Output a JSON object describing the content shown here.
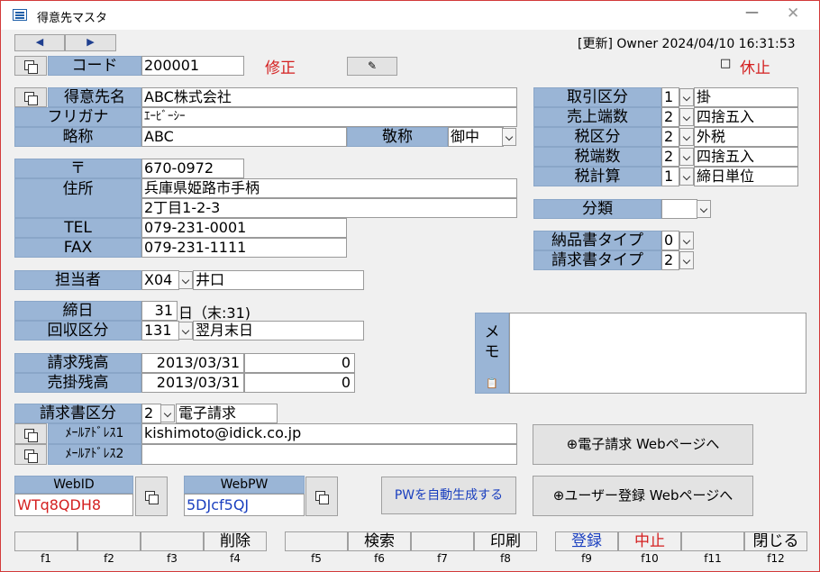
{
  "window": {
    "title": "得意先マスタ",
    "minimize": "—",
    "close": "✕"
  },
  "nav": {
    "prev": "◀",
    "next": "▶"
  },
  "status": "[更新] Owner 2024/04/10 16:31:53",
  "code": {
    "label": "コード",
    "value": "200001",
    "mode": "修正"
  },
  "inactive": {
    "checkbox": "□",
    "label": "休止"
  },
  "customer": {
    "name_label": "得意先名",
    "name": "ABC株式会社",
    "kana_label": "フリガナ",
    "kana": "ｴｰﾋﾞｰｼｰ",
    "short_label": "略称",
    "short": "ABC",
    "honorific_label": "敬称",
    "honorific": "御中"
  },
  "address": {
    "zip_label": "〒",
    "zip": "670-0972",
    "addr_label": "住所",
    "addr1": "兵庫県姫路市手柄",
    "addr2": "2丁目1-2-3",
    "tel_label": "TEL",
    "tel": "079-231-0001",
    "fax_label": "FAX",
    "fax": "079-231-1111"
  },
  "staff": {
    "label": "担当者",
    "code": "X04",
    "name": "井口"
  },
  "closing": {
    "label": "締日",
    "day": "31",
    "suffix": "日（末:31)"
  },
  "collection": {
    "label": "回収区分",
    "code": "131",
    "name": "翌月末日"
  },
  "balances": {
    "billing_label": "請求残高",
    "billing_date": "2013/03/31",
    "billing_value": "0",
    "ar_label": "売掛残高",
    "ar_date": "2013/03/31",
    "ar_value": "0"
  },
  "billing": {
    "label": "請求書区分",
    "code": "2",
    "name": "電子請求"
  },
  "mail": {
    "label1": "ﾒｰﾙｱﾄﾞﾚｽ1",
    "value1": "kishimoto@idick.co.jp",
    "label2": "ﾒｰﾙｱﾄﾞﾚｽ2",
    "value2": ""
  },
  "web": {
    "id_label": "WebID",
    "id_value": "WTq8QDH8",
    "pw_label": "WebPW",
    "pw_value": "5DJcf5QJ",
    "autogen": "PWを自動生成する"
  },
  "trade": {
    "rows": [
      {
        "label": "取引区分",
        "code": "1",
        "name": "掛"
      },
      {
        "label": "売上端数",
        "code": "2",
        "name": "四捨五入"
      },
      {
        "label": "税区分",
        "code": "2",
        "name": "外税"
      },
      {
        "label": "税端数",
        "code": "2",
        "name": "四捨五入"
      },
      {
        "label": "税計算",
        "code": "1",
        "name": "締日単位"
      }
    ]
  },
  "category": {
    "label": "分類",
    "value": ""
  },
  "delivery": {
    "label": "納品書タイプ",
    "value": "0"
  },
  "invoice": {
    "label": "請求書タイプ",
    "value": "2"
  },
  "memo": {
    "label": "メモ",
    "value": ""
  },
  "links": {
    "ebill": "⊕電子請求 Webページへ",
    "register": "⊕ユーザー登録 Webページへ"
  },
  "fkeys": {
    "labels": [
      "",
      "",
      "",
      "削除",
      "",
      "検索",
      "",
      "印刷",
      "登録",
      "中止",
      "",
      "閉じる"
    ],
    "names": [
      "f1",
      "f2",
      "f3",
      "f4",
      "f5",
      "f6",
      "f7",
      "f8",
      "f9",
      "f10",
      "f11",
      "f12"
    ]
  },
  "colors": {
    "label_bg": "#9ab5d6",
    "red": "#d42020",
    "blue": "#1a3fbf"
  }
}
